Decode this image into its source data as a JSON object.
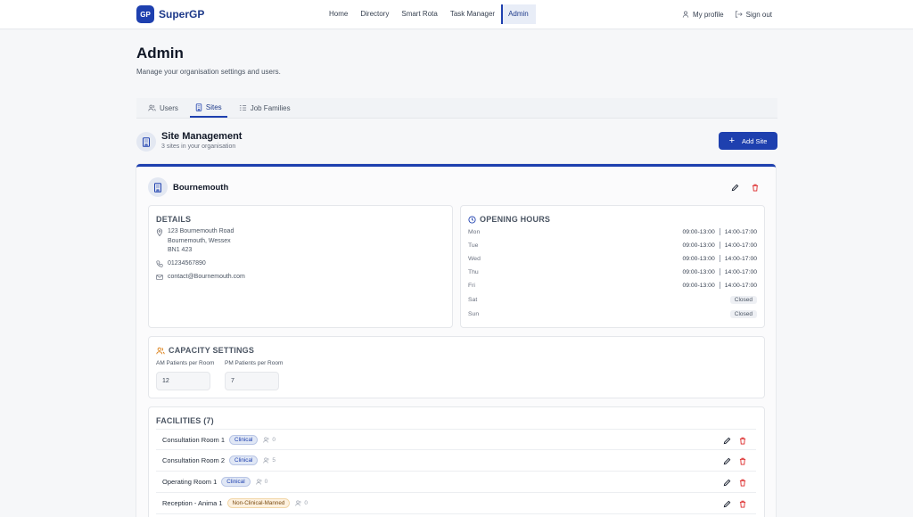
{
  "app": {
    "logo_badge": "GP",
    "name": "SuperGP"
  },
  "nav": {
    "items": [
      {
        "label": "Home",
        "active": false
      },
      {
        "label": "Directory",
        "active": false
      },
      {
        "label": "Smart Rota",
        "active": false
      },
      {
        "label": "Task Manager",
        "active": false
      },
      {
        "label": "Admin",
        "active": true
      }
    ],
    "my_profile": "My profile",
    "sign_out": "Sign out"
  },
  "page": {
    "title": "Admin",
    "subtitle": "Manage your organisation settings and users."
  },
  "tabs": [
    {
      "label": "Users",
      "icon": "users-icon",
      "active": false
    },
    {
      "label": "Sites",
      "icon": "building-icon",
      "active": true
    },
    {
      "label": "Job Families",
      "icon": "list-icon",
      "active": false
    }
  ],
  "site_management": {
    "title": "Site Management",
    "subtitle": "3 sites in your organisation",
    "add_button": "Add Site"
  },
  "site": {
    "name": "Bournemouth",
    "details": {
      "title": "DETAILS",
      "address_line1": "123 Bournemouth Road",
      "address_line2": "Bournemouth, Wessex",
      "address_line3": "BN1 423",
      "phone": "01234567890",
      "email": "contact@Bournemouth.com"
    },
    "opening_hours": {
      "title": "OPENING HOURS",
      "days": [
        {
          "day": "Mon",
          "am": "09:00-13:00",
          "pm": "14:00-17:00",
          "closed": false
        },
        {
          "day": "Tue",
          "am": "09:00-13:00",
          "pm": "14:00-17:00",
          "closed": false
        },
        {
          "day": "Wed",
          "am": "09:00-13:00",
          "pm": "14:00-17:00",
          "closed": false
        },
        {
          "day": "Thu",
          "am": "09:00-13:00",
          "pm": "14:00-17:00",
          "closed": false
        },
        {
          "day": "Fri",
          "am": "09:00-13:00",
          "pm": "14:00-17:00",
          "closed": false
        },
        {
          "day": "Sat",
          "label": "Closed",
          "closed": true
        },
        {
          "day": "Sun",
          "label": "Closed",
          "closed": true
        }
      ]
    },
    "capacity": {
      "title": "CAPACITY SETTINGS",
      "am_label": "AM Patients per Room",
      "am_value": "12",
      "pm_label": "PM Patients per Room",
      "pm_value": "7"
    },
    "facilities": {
      "title": "FACILITIES (7)",
      "items": [
        {
          "name": "Consultation Room 1",
          "type": "Clinical",
          "count": "0"
        },
        {
          "name": "Consultation Room 2",
          "type": "Clinical",
          "count": "5"
        },
        {
          "name": "Operating Room 1",
          "type": "Clinical",
          "count": "0"
        },
        {
          "name": "Reception - Anima 1",
          "type": "Non-Clinical-Manned",
          "count": "0"
        }
      ]
    }
  },
  "colors": {
    "primary": "#1e40af",
    "danger": "#dc2626",
    "background": "#f6f7f9"
  }
}
